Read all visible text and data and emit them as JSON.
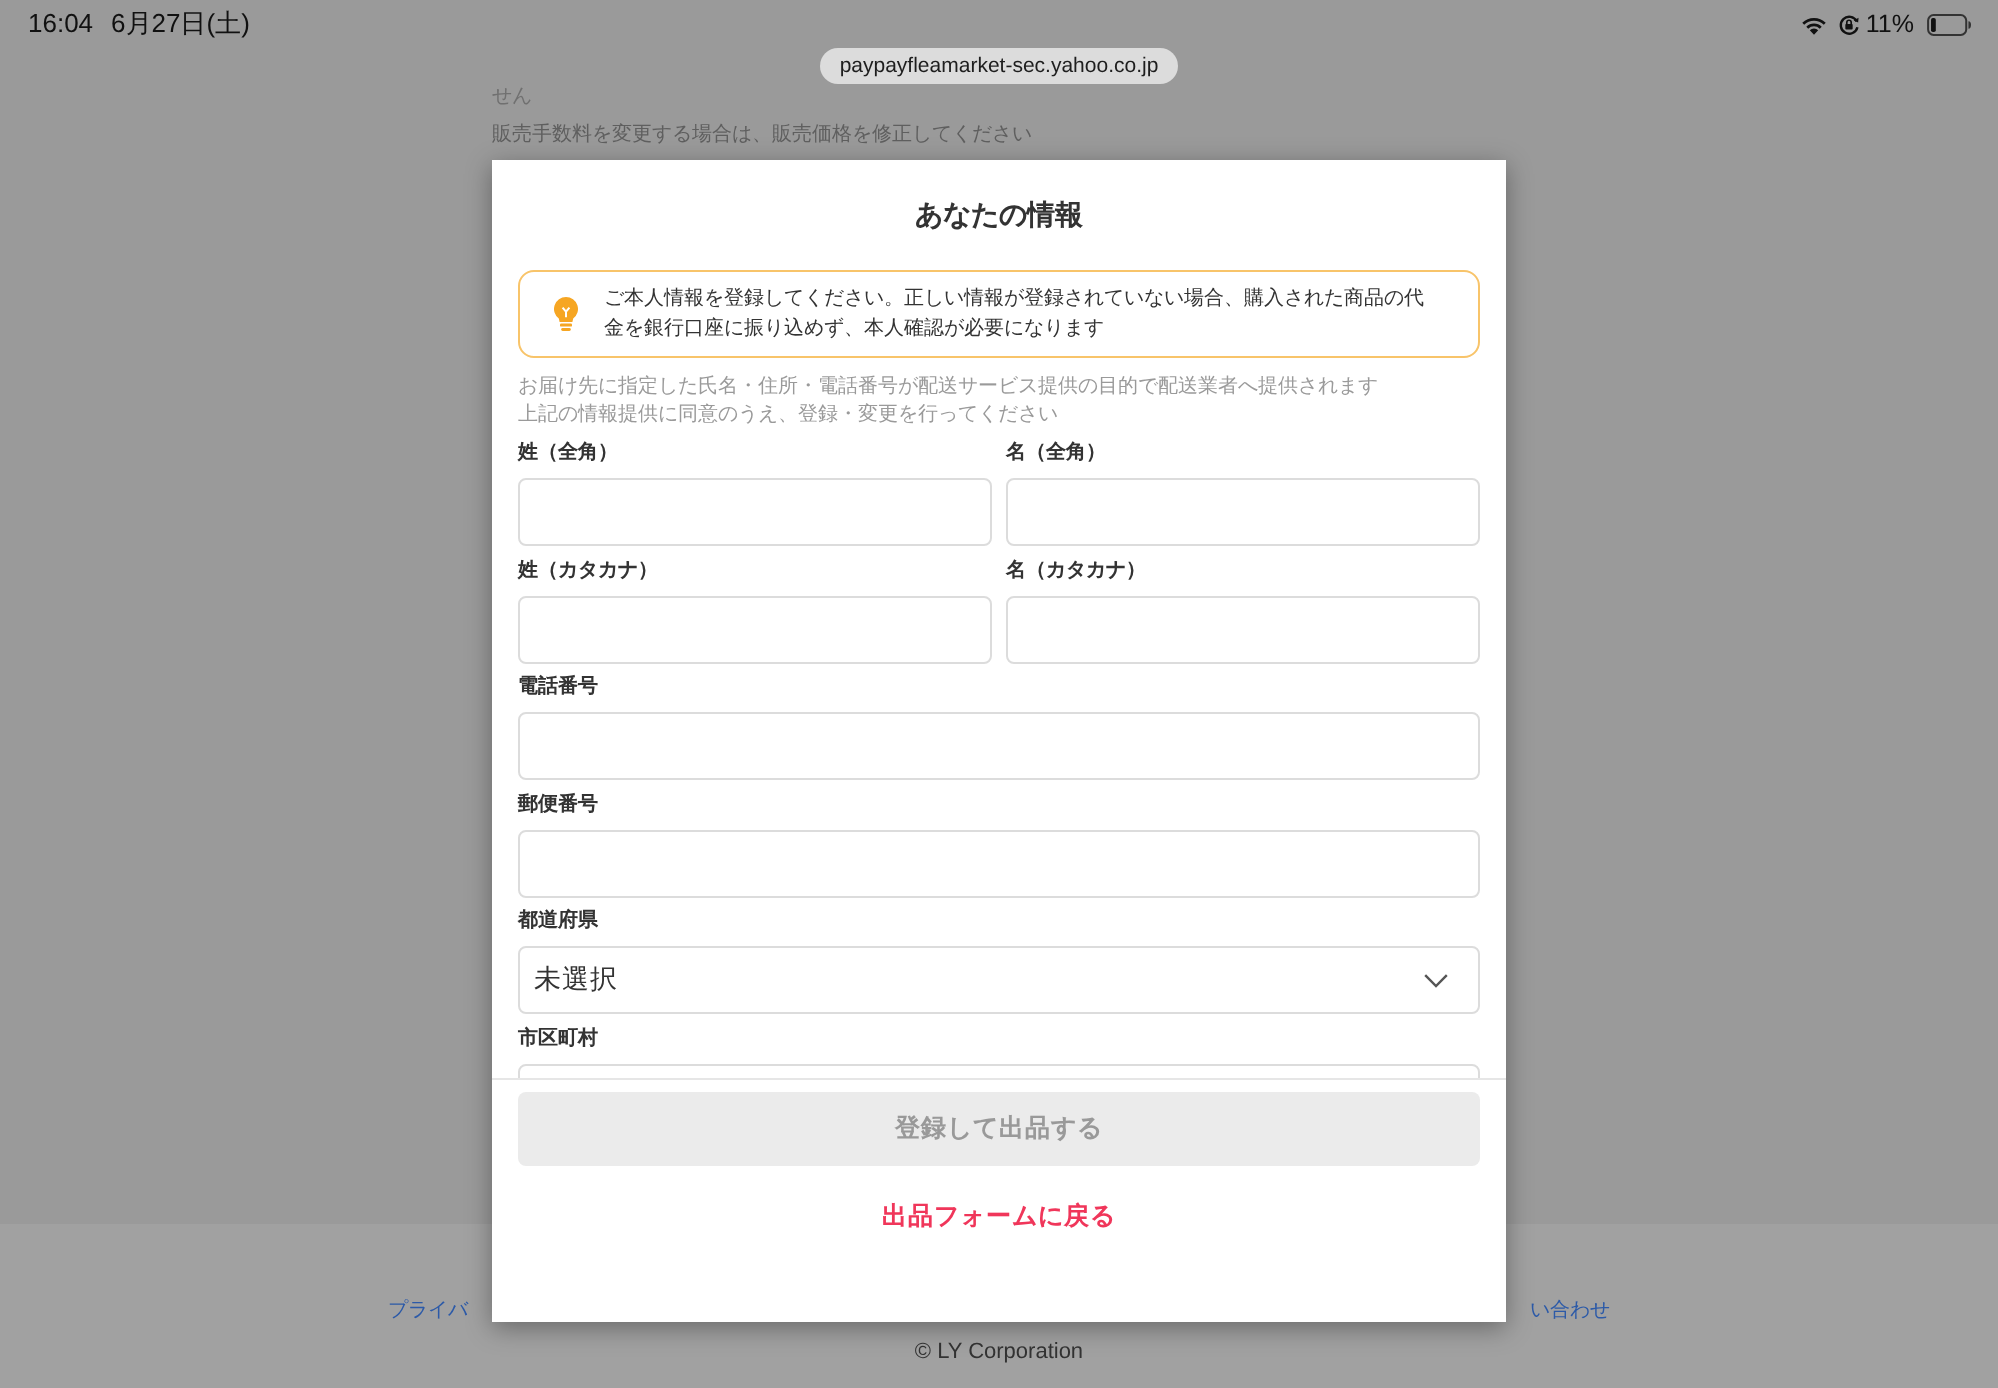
{
  "status_bar": {
    "time": "16:04",
    "date": "6月27日(土)",
    "battery": "11%"
  },
  "url_bar": {
    "url": "paypayfleamarket-sec.yahoo.co.jp"
  },
  "page": {
    "texts": [
      "せん",
      "販売手数料を変更する場合は、販売価格を修正してください"
    ]
  },
  "footer": {
    "links": [
      "プライバ",
      "い合わせ"
    ],
    "copyright": "© LY Corporation"
  },
  "modal": {
    "title": "あなたの情報",
    "notice": "ご本人情報を登録してください。正しい情報が登録されていない場合、購入された商品の代金を銀行口座に振り込めず、本人確認が必要になります",
    "consent": [
      "お届け先に指定した氏名・住所・電話番号が配送サービス提供の目的で配送業者へ提供されます",
      "上記の情報提供に同意のうえ、登録・変更を行ってください"
    ],
    "field_rows": [
      [
        {
          "label": "姓（全角）",
          "kind": "text"
        },
        {
          "label": "名（全角）",
          "kind": "text"
        }
      ],
      [
        {
          "label": "姓（カタカナ）",
          "kind": "text"
        },
        {
          "label": "名（カタカナ）",
          "kind": "text"
        }
      ],
      [
        {
          "label": "電話番号",
          "kind": "text"
        }
      ],
      [
        {
          "label": "郵便番号",
          "kind": "text"
        }
      ],
      [
        {
          "label": "都道府県",
          "kind": "select",
          "value": "未選択"
        }
      ],
      [
        {
          "label": "市区町村",
          "kind": "text"
        }
      ]
    ],
    "submit_button": {
      "label": "登録して出品する",
      "disabled": true
    },
    "back_link": {
      "label": "出品フォームに戻る"
    }
  }
}
